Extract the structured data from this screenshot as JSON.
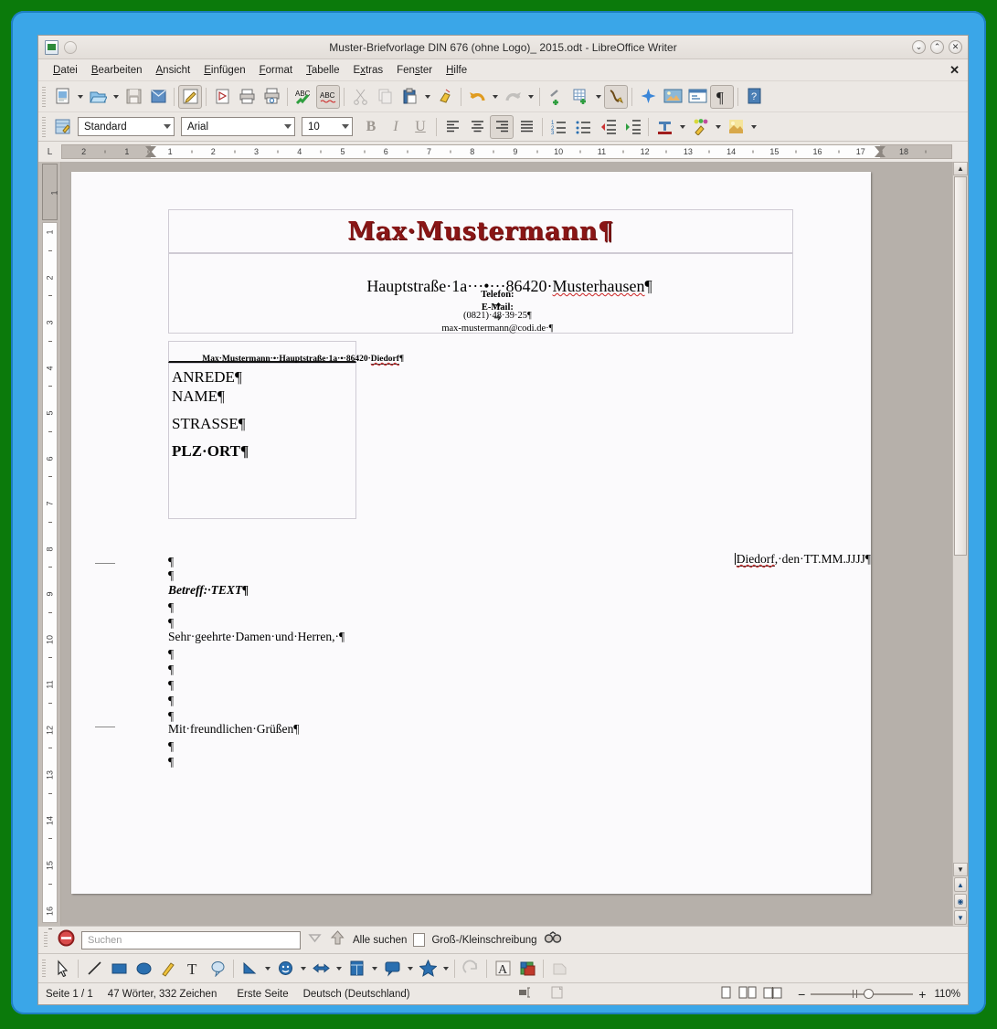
{
  "window": {
    "title": "Muster-Briefvorlage DIN 676 (ohne Logo)_ 2015.odt - LibreOffice Writer",
    "minimize": "⌄",
    "maximize": "⌃",
    "close": "✕",
    "doc_close": "✕"
  },
  "menu": [
    {
      "label": "Datei",
      "accel": "D"
    },
    {
      "label": "Bearbeiten",
      "accel": "B"
    },
    {
      "label": "Ansicht",
      "accel": "A"
    },
    {
      "label": "Einfügen",
      "accel": "E"
    },
    {
      "label": "Format",
      "accel": "F"
    },
    {
      "label": "Tabelle",
      "accel": "T"
    },
    {
      "label": "Extras",
      "accel": "x"
    },
    {
      "label": "Fenster",
      "accel": "s"
    },
    {
      "label": "Hilfe",
      "accel": "H"
    }
  ],
  "standard_toolbar": [
    {
      "name": "new-document-icon",
      "tooltip": "Neu"
    },
    {
      "name": "new-dropdown-icon",
      "tooltip": "Neu (Auswahl)"
    },
    {
      "name": "open-document-icon",
      "tooltip": "Öffnen"
    },
    {
      "name": "open-dropdown-icon",
      "tooltip": "Öffnen (Auswahl)"
    },
    {
      "name": "save-icon",
      "tooltip": "Speichern"
    },
    {
      "name": "email-document-icon",
      "tooltip": "Direkt als E-Mail"
    },
    {
      "name": "edit-mode-icon",
      "tooltip": "Bearbeiten-Modus"
    },
    {
      "name": "export-pdf-icon",
      "tooltip": "Direktes Exportieren als PDF"
    },
    {
      "name": "print-icon",
      "tooltip": "Direktdruck"
    },
    {
      "name": "print-preview-icon",
      "tooltip": "Seitenansicht"
    },
    {
      "name": "spelling-icon",
      "tooltip": "Rechtschreibung"
    },
    {
      "name": "autospellcheck-icon",
      "tooltip": "Automatische Rechtschreibprüfung"
    },
    {
      "name": "cut-icon",
      "tooltip": "Ausschneiden"
    },
    {
      "name": "copy-icon",
      "tooltip": "Kopieren"
    },
    {
      "name": "paste-icon",
      "tooltip": "Einfügen"
    },
    {
      "name": "paste-dropdown-icon",
      "tooltip": "Einfügen (Auswahl)"
    },
    {
      "name": "clone-formatting-icon",
      "tooltip": "Formatpinsel"
    },
    {
      "name": "undo-icon",
      "tooltip": "Rückgängig"
    },
    {
      "name": "undo-dropdown-icon",
      "tooltip": "Rückgängig (Liste)"
    },
    {
      "name": "redo-icon",
      "tooltip": "Wiederherstellen"
    },
    {
      "name": "redo-dropdown-icon",
      "tooltip": "Wiederherstellen (Liste)"
    },
    {
      "name": "hyperlink-icon",
      "tooltip": "Hyperlink einfügen"
    },
    {
      "name": "insert-table-icon",
      "tooltip": "Tabelle einfügen"
    },
    {
      "name": "insert-table-dropdown-icon",
      "tooltip": "Tabelle (Auswahl)"
    },
    {
      "name": "draw-functions-icon",
      "tooltip": "Zeichnungsfunktionen"
    },
    {
      "name": "special-character-icon",
      "tooltip": "Sonderzeichen"
    },
    {
      "name": "insert-image-icon",
      "tooltip": "Bild einfügen"
    },
    {
      "name": "insert-text-box-icon",
      "tooltip": "Textrahmen einfügen"
    },
    {
      "name": "formatting-marks-icon",
      "tooltip": "Formatierungszeichen"
    },
    {
      "name": "help-icon",
      "tooltip": "Hilfe"
    }
  ],
  "formatting_toolbar": {
    "styles_icon": "paragraph-style-icon",
    "paragraph_style": "Standard",
    "font_name": "Arial",
    "font_size": "10",
    "bold": "B",
    "italic": "I",
    "underline": "U",
    "buttons": [
      {
        "name": "align-left-icon",
        "active": false
      },
      {
        "name": "align-center-icon",
        "active": false
      },
      {
        "name": "align-right-icon",
        "active": true
      },
      {
        "name": "align-justified-icon",
        "active": false
      },
      {
        "name": "ordered-list-icon",
        "active": false
      },
      {
        "name": "unordered-list-icon",
        "active": false
      },
      {
        "name": "decrease-indent-icon",
        "active": false
      },
      {
        "name": "increase-indent-icon",
        "active": false
      },
      {
        "name": "font-color-icon",
        "active": false
      },
      {
        "name": "highlighting-color-icon",
        "active": false
      },
      {
        "name": "background-color-icon",
        "active": false
      }
    ]
  },
  "ruler": {
    "corner_label": "L",
    "horizontal_left_ticks": [
      "2",
      "1"
    ],
    "horizontal_ticks": [
      "1",
      "2",
      "3",
      "4",
      "5",
      "6",
      "7",
      "8",
      "9",
      "10",
      "11",
      "12",
      "13",
      "14",
      "15",
      "16"
    ],
    "horizontal_right_ticks": [
      "17",
      "18"
    ],
    "vertical_head": "1",
    "vertical_ticks": [
      "1",
      "2",
      "3",
      "4",
      "5",
      "6",
      "7",
      "8",
      "9",
      "10",
      "11",
      "12",
      "13",
      "14",
      "15",
      "16"
    ]
  },
  "document": {
    "letterhead_name": "Max·Mustermann¶",
    "letterhead_address": "Hauptstraße·1a···•···86420·Musterhausen¶",
    "phone_label": "Telefon:",
    "phone_tab": "➜",
    "phone_value": "(0821)·48·39·25¶",
    "email_label": "E-Mail:",
    "email_tab": "➜",
    "email_value": "max-mustermann@codi.de·¶",
    "sender_line": "Max·Mustermann·•·Hauptstraße·1a·•·86420·",
    "sender_city": "Diedorf",
    "sender_pilcrow": "¶",
    "address_block": [
      "ANREDE¶",
      "NAME¶",
      "STRASSE¶",
      "PLZ·ORT¶"
    ],
    "date_city": "Diedorf",
    "date_rest": ",·den·TT.MM.JJJJ¶",
    "empty_paragraph": "¶",
    "subject": "Betreff:·TEXT¶",
    "salutation": "Sehr·geehrte·Damen·und·Herren,·¶",
    "closing": "Mit·freundlichen·Grüßen¶"
  },
  "find_toolbar": {
    "close_icon": "close-find-icon",
    "search_placeholder": "Suchen",
    "find_next_icon": "find-next-icon",
    "find_previous_icon": "find-previous-icon",
    "find_all_label": "Alle suchen",
    "match_case_label": "Groß-/Kleinschreibung",
    "find_replace_icon": "find-and-replace-icon"
  },
  "drawing_toolbar": [
    {
      "name": "select-arrow-icon"
    },
    {
      "name": "line-icon"
    },
    {
      "name": "rectangle-icon"
    },
    {
      "name": "ellipse-icon"
    },
    {
      "name": "freeform-line-icon"
    },
    {
      "name": "text-box-icon"
    },
    {
      "name": "callout-icon"
    },
    {
      "name": "basic-shapes-icon"
    },
    {
      "name": "symbol-shapes-icon"
    },
    {
      "name": "block-arrows-icon"
    },
    {
      "name": "flowchart-shapes-icon"
    },
    {
      "name": "callout-shapes-icon"
    },
    {
      "name": "stars-icon"
    },
    {
      "name": "rotate-icon"
    },
    {
      "name": "fontwork-icon"
    },
    {
      "name": "from-file-icon"
    },
    {
      "name": "extrusion-on-off-icon"
    }
  ],
  "status_bar": {
    "page": "Seite 1 / 1",
    "word_count": "47 Wörter, 332 Zeichen",
    "page_style": "Erste Seite",
    "language": "Deutsch (Deutschland)",
    "selection_icon": "selection-mode-icon",
    "save_icon": "document-modified-icon",
    "view_single": "single-page-view-icon",
    "view_multi": "multi-page-view-icon",
    "view_book": "book-view-icon",
    "zoom_out": "−",
    "zoom_in": "+",
    "zoom_level": "110%"
  },
  "colors": {
    "desktop": "#0b7a0b",
    "window_frame": "#3aa6e8",
    "toolbar_bg": "#ece8e4",
    "canvas_bg": "#b6b0aa",
    "page_bg": "#fbfafc",
    "logo_red": "#8a1616",
    "spellcheck_red": "#cc2222"
  }
}
